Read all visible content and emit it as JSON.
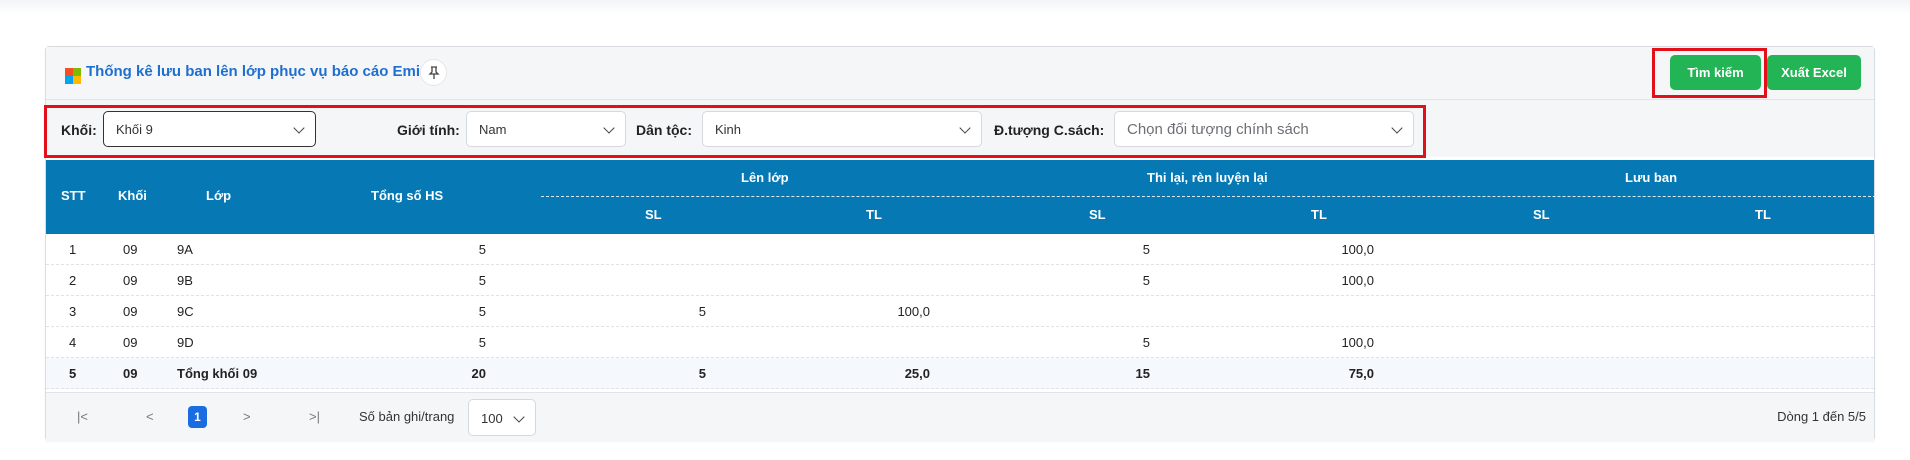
{
  "header": {
    "title": "Thống kê lưu ban lên lớp phục vụ báo cáo Emis",
    "pin_icon": "pin-icon",
    "logo_colors": [
      "#f25022",
      "#7fba00",
      "#00a4ef",
      "#ffb900"
    ],
    "search_button": "Tìm kiếm",
    "excel_button": "Xuất Excel"
  },
  "filters": {
    "khoi": {
      "label": "Khối:",
      "value": "Khối 9"
    },
    "gioi_tinh": {
      "label": "Giới tính:",
      "value": "Nam"
    },
    "dan_toc": {
      "label": "Dân tộc:",
      "value": "Kinh"
    },
    "doi_tuong": {
      "label": "Đ.tượng C.sách:",
      "placeholder": "Chọn đối tượng chính sách"
    }
  },
  "table": {
    "columns": {
      "stt": "STT",
      "khoi": "Khối",
      "lop": "Lớp",
      "tong_so_hs": "Tổng số HS",
      "len_lop": "Lên lớp",
      "thi_lai": "Thi lại, rèn luyện lại",
      "luu_ban": "Lưu ban",
      "sl": "SL",
      "tl": "TL"
    },
    "rows": [
      {
        "stt": "1",
        "khoi": "09",
        "lop": "9A",
        "tong": "5",
        "len_sl": "",
        "len_tl": "",
        "thi_sl": "5",
        "thi_tl": "100,0",
        "luu_sl": "",
        "luu_tl": ""
      },
      {
        "stt": "2",
        "khoi": "09",
        "lop": "9B",
        "tong": "5",
        "len_sl": "",
        "len_tl": "",
        "thi_sl": "5",
        "thi_tl": "100,0",
        "luu_sl": "",
        "luu_tl": ""
      },
      {
        "stt": "3",
        "khoi": "09",
        "lop": "9C",
        "tong": "5",
        "len_sl": "5",
        "len_tl": "100,0",
        "thi_sl": "",
        "thi_tl": "",
        "luu_sl": "",
        "luu_tl": ""
      },
      {
        "stt": "4",
        "khoi": "09",
        "lop": "9D",
        "tong": "5",
        "len_sl": "",
        "len_tl": "",
        "thi_sl": "5",
        "thi_tl": "100,0",
        "luu_sl": "",
        "luu_tl": ""
      }
    ],
    "total": {
      "stt": "5",
      "khoi": "09",
      "lop": "Tổng khối 09",
      "tong": "20",
      "len_sl": "5",
      "len_tl": "25,0",
      "thi_sl": "15",
      "thi_tl": "75,0",
      "luu_sl": "",
      "luu_tl": ""
    }
  },
  "pagination": {
    "first": "|<",
    "prev": "<",
    "current_page": "1",
    "next": ">",
    "last": ">|",
    "per_page_label": "Số bản ghi/trang",
    "per_page_value": "100",
    "summary": "Dòng 1 đến 5/5"
  },
  "colors": {
    "accent_blue": "#0678b4",
    "button_green": "#22b455",
    "highlight_red": "#e3101a",
    "title_blue": "#1f6fcf"
  }
}
